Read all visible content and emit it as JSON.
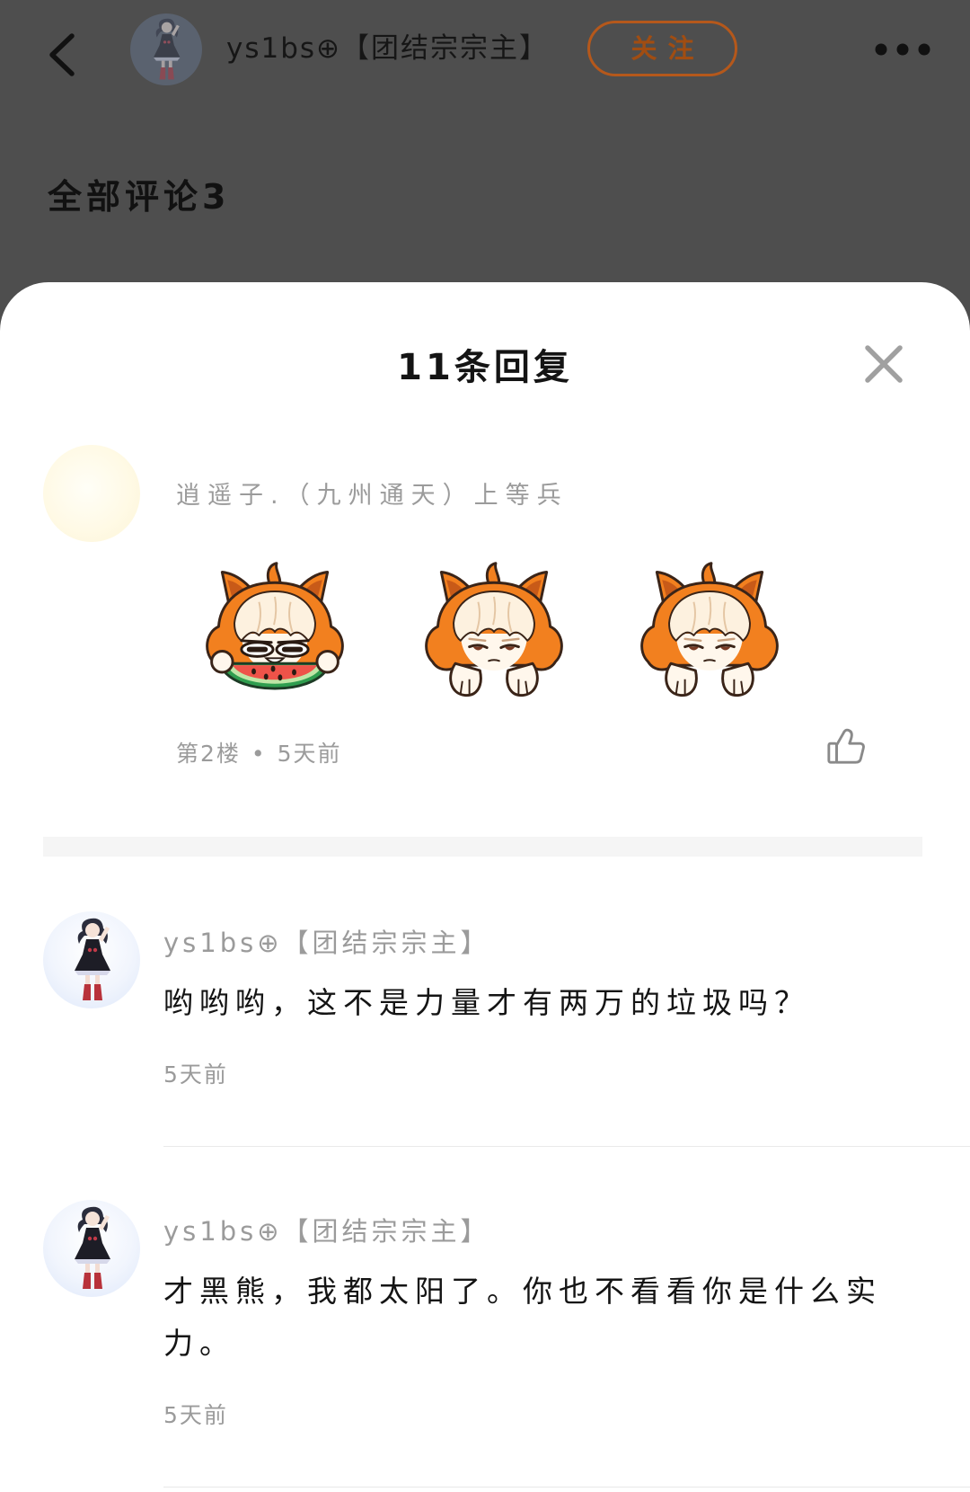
{
  "colors": {
    "overlay": "#4e4e4e",
    "sheet": "#ffffff",
    "accent": "#b5581b",
    "accent_text": "#a14d12",
    "text_primary": "#141414",
    "text_secondary": "#9b9b9b",
    "divider": "#f5f5f5",
    "hairline": "#e9e9e9"
  },
  "top_bar": {
    "back_icon": "chevron-left-icon",
    "author": {
      "avatar": "avatar-icon",
      "name": "ys1bs⊕【团结宗宗主】"
    },
    "follow_label": "关注",
    "more_icon": "more-dots-icon"
  },
  "comments_header": {
    "label": "全部评论3"
  },
  "reply_sheet": {
    "title": "11条回复",
    "close_icon": "close-icon",
    "main_comment": {
      "avatar": "avatar-icon",
      "user_name": "逍遥子.（九州通天）上等兵",
      "stickers": [
        {
          "icon": "sticker-eating-watermelon"
        },
        {
          "icon": "sticker-sulky"
        },
        {
          "icon": "sticker-sulky"
        }
      ],
      "floor": "第2楼",
      "separator": "•",
      "time": "5天前",
      "like_icon": "thumbs-up-icon"
    },
    "replies": [
      {
        "avatar": "avatar-icon",
        "user_name": "ys1bs⊕【团结宗宗主】",
        "text": "哟哟哟，这不是力量才有两万的垃圾吗？",
        "time": "5天前"
      },
      {
        "avatar": "avatar-icon",
        "user_name": "ys1bs⊕【团结宗宗主】",
        "text": "才黑熊，我都太阳了。你也不看看你是什么实力。",
        "time": "5天前"
      }
    ]
  }
}
